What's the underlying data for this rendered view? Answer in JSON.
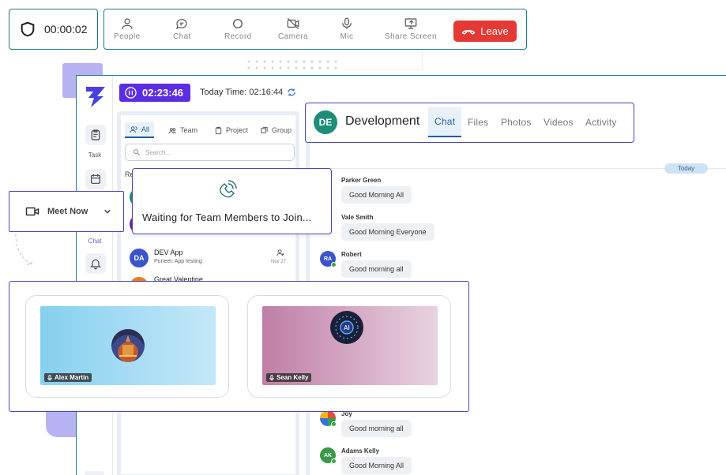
{
  "call_bar": {
    "timer": "00:00:02",
    "controls": [
      {
        "label": "People",
        "icon": "people-icon"
      },
      {
        "label": "Chat",
        "icon": "chat-icon"
      },
      {
        "label": "Record",
        "icon": "record-icon"
      },
      {
        "label": "Camera",
        "icon": "camera-off-icon"
      },
      {
        "label": "Mic",
        "icon": "mic-icon"
      },
      {
        "label": "Share Screen",
        "icon": "share-screen-icon"
      }
    ],
    "leave_label": "Leave"
  },
  "app": {
    "rail": {
      "task_label": "Task",
      "chat_label": "Chat"
    },
    "timer": "02:23:46",
    "today_time": "Today Time: 02:16:44"
  },
  "chat_list": {
    "tabs": [
      "All",
      "Team",
      "Project",
      "Group"
    ],
    "search_placeholder": "Search...",
    "recent_label": "Recent",
    "dev_app": {
      "initials": "DA",
      "name": "DEV App",
      "preview": "Puneet: App testing",
      "date": "Nov 27"
    },
    "next_name": "Great Valentine"
  },
  "conversation": {
    "avatar_initials": "DE",
    "title": "Development",
    "tabs": [
      "Chat",
      "Files",
      "Photos",
      "Videos",
      "Activity"
    ],
    "today_label": "Today",
    "messages": [
      {
        "name": "Parker Green",
        "text": "Good Morning All"
      },
      {
        "name": "Vale Smith",
        "text": "Good Morning Everyone"
      },
      {
        "name": "Robert",
        "initials": "RA",
        "text": "Good morning all"
      },
      {
        "name": "Joy",
        "text": "Good morning all"
      },
      {
        "name": "Adams Kelly",
        "initials": "AK",
        "text": "Good Morning All"
      }
    ]
  },
  "waiting": {
    "text": "Waiting for Team Members to Join..."
  },
  "meet_now": {
    "label": "Meet Now"
  },
  "participants": [
    {
      "name": "Alex Martin"
    },
    {
      "name": "Sean Kelly"
    }
  ],
  "colors": {
    "teal_border": "#1c7c86",
    "overlay_border": "#4848b8",
    "leave_red": "#e53935",
    "timer_purple": "#5b2de2",
    "accent_blue": "#1f5f9c"
  }
}
